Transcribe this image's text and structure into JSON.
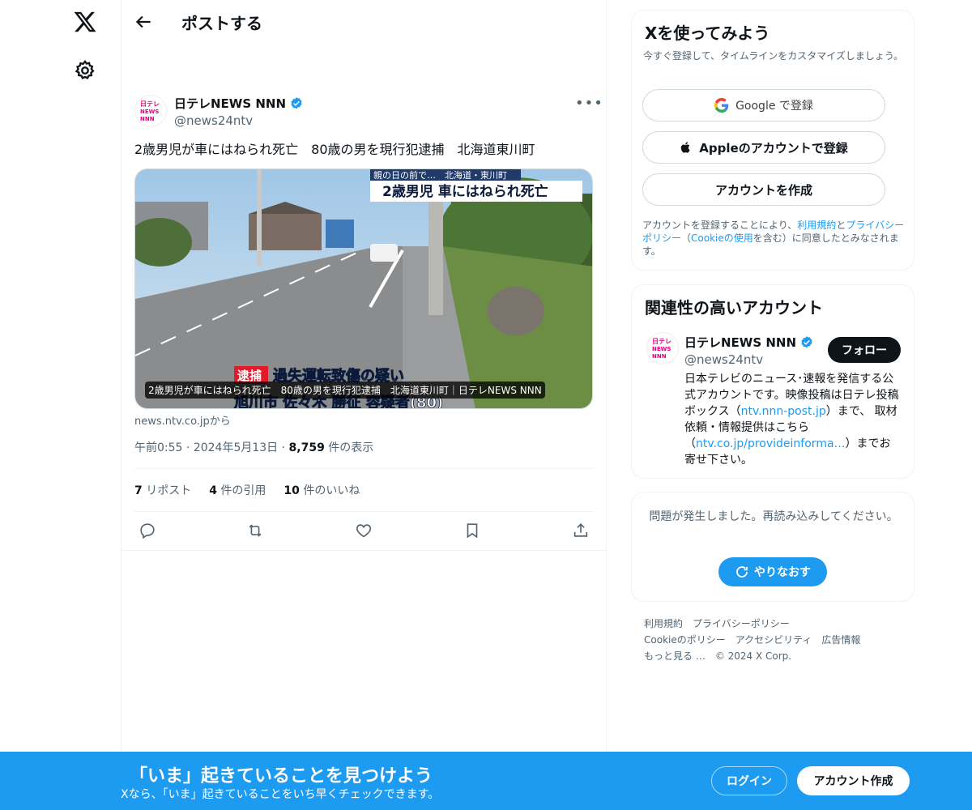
{
  "nav": {
    "logo_icon": "x-logo-icon",
    "settings_icon": "gear-icon"
  },
  "header": {
    "title": "ポストする"
  },
  "post": {
    "author_name": "日テレNEWS NNN",
    "author_handle": "@news24ntv",
    "avatar_text_lines": [
      "日テレ",
      "NEWS",
      "NNN"
    ],
    "text": "2歳男児が車にはねられ死亡　80歳の男を現行犯逮捕　北海道東川町",
    "media": {
      "overlay_top_small": "親の日の前で…　北海道・東川町",
      "overlay_top_big": "2歳男児 車にはねられ死亡",
      "overlay_tag": "逮捕",
      "overlay_bottom": "過失運転致傷の疑い",
      "overlay_bottom_name": "旭川市 佐々木 勝征 容疑者(80)",
      "caption": "2歳男児が車にはねられ死亡　80歳の男を現行犯逮捕　北海道東川町｜日テレNEWS NNN"
    },
    "source": "news.ntv.co.jpから",
    "time": "午前0:55",
    "date": "2024年5月13日",
    "views_count": "8,759",
    "views_label": "件の表示",
    "reposts_count": "7",
    "reposts_label": "リポスト",
    "quotes_count": "4",
    "quotes_label": "件の引用",
    "likes_count": "10",
    "likes_label": "件のいいね"
  },
  "signup": {
    "title": "Xを使ってみよう",
    "subtitle": "今すぐ登録して、タイムラインをカスタマイズしましょう。",
    "google_label": "Google で登録",
    "apple_label": "Appleのアカウントで登録",
    "create_label": "アカウントを作成",
    "terms_prefix": "アカウントを登録することにより、",
    "terms_link": "利用規約",
    "terms_and": "と",
    "privacy_link": "プライバシーポリシー",
    "terms_mid": "（",
    "cookie_link": "Cookieの使用",
    "terms_suffix": "を含む）に同意したとみなされます。"
  },
  "related": {
    "title": "関連性の高いアカウント",
    "name": "日テレNEWS NNN",
    "handle": "@news24ntv",
    "follow_label": "フォロー",
    "bio_1": "日本テレビのニュース･速報を発信する公式アカウントです。映像投稿は日テレ投稿ボックス（",
    "bio_link_1": "ntv.nnn-post.jp",
    "bio_2": "）まで、 取材依頼・情報提供はこちら（",
    "bio_link_2": "ntv.co.jp/provideinforma…",
    "bio_3": "）までお寄せ下さい。"
  },
  "error": {
    "text": "問題が発生しました。再読み込みしてください。",
    "retry_label": "やりなおす"
  },
  "footer": {
    "links": [
      "利用規約",
      "プライバシーポリシー",
      "Cookieのポリシー",
      "アクセシビリティ",
      "広告情報",
      "もっと見る …",
      "© 2024 X Corp."
    ]
  },
  "bottom_bar": {
    "title": "「いま」起きていることを見つけよう",
    "subtitle": "Xなら、「いま」起きていることをいち早くチェックできます。",
    "login_label": "ログイン",
    "create_label": "アカウント作成"
  },
  "colors": {
    "accent": "#1d9bf0",
    "text": "#0f1419",
    "muted": "#536471",
    "border": "#eff3f4"
  }
}
